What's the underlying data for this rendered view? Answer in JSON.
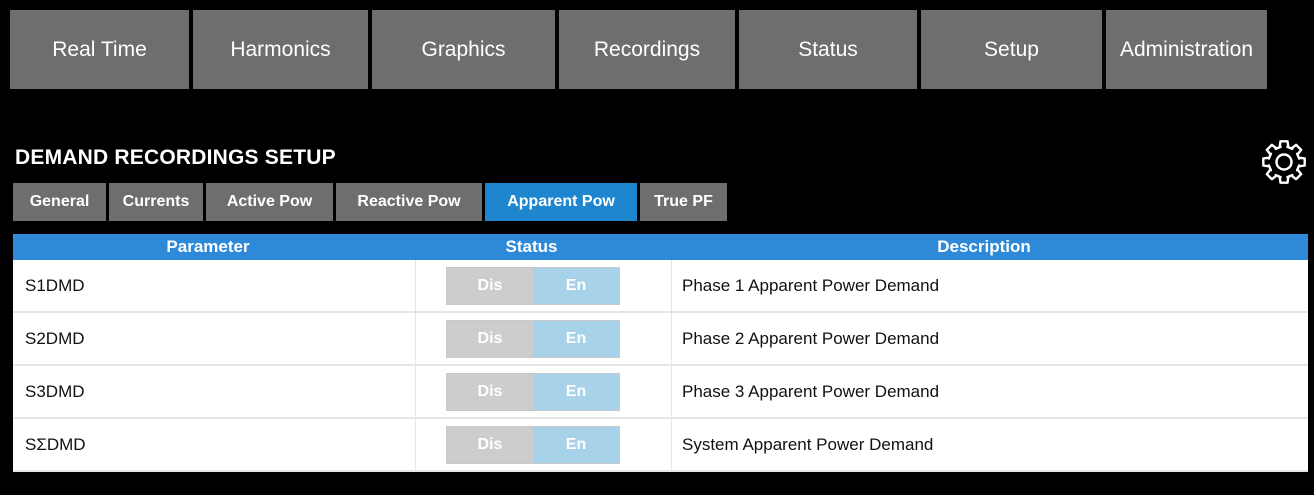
{
  "nav": [
    "Real Time",
    "Harmonics",
    "Graphics",
    "Recordings",
    "Status",
    "Setup",
    "Administration"
  ],
  "page_title": "DEMAND RECORDINGS SETUP",
  "gear_icon": "gear-icon",
  "tabs": [
    "General",
    "Currents",
    "Active Pow",
    "Reactive Pow",
    "Apparent Pow",
    "True PF"
  ],
  "active_tab": "Apparent Pow",
  "table": {
    "headers": {
      "parameter": "Parameter",
      "status": "Status",
      "description": "Description"
    },
    "toggle": {
      "off_label": "Dis",
      "on_label": "En"
    },
    "rows": [
      {
        "parameter": "S1DMD",
        "description": "Phase 1 Apparent Power Demand"
      },
      {
        "parameter": "S2DMD",
        "description": "Phase 2 Apparent Power Demand"
      },
      {
        "parameter": "S3DMD",
        "description": "Phase 3 Apparent Power Demand"
      },
      {
        "parameter": "SΣDMD",
        "description": "System Apparent Power Demand"
      }
    ]
  },
  "colors": {
    "nav_bg": "#6e6e6e",
    "accent": "#2e8ad8",
    "active_tab": "#1e86cf",
    "en_bg": "#a7d2ea",
    "dis_bg": "#cdcdcd"
  }
}
